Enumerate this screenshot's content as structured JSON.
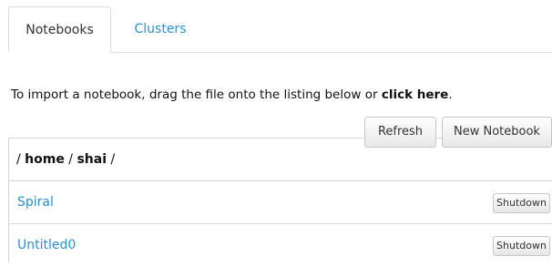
{
  "tabs": {
    "notebooks_label": "Notebooks",
    "clusters_label": "Clusters"
  },
  "instructions": {
    "text": "To import a notebook, drag the file onto the listing below or ",
    "link": "click here",
    "suffix": "."
  },
  "toolbar": {
    "refresh_label": "Refresh",
    "new_notebook_label": "New Notebook"
  },
  "breadcrumb": {
    "sep": "/",
    "home": "home",
    "user": "shai"
  },
  "notebooks": [
    {
      "name": "Spiral",
      "action_label": "Shutdown"
    },
    {
      "name": "Untitled0",
      "action_label": "Shutdown"
    }
  ],
  "colors": {
    "link": "#2a8fd0",
    "border": "#d6d6d6"
  }
}
